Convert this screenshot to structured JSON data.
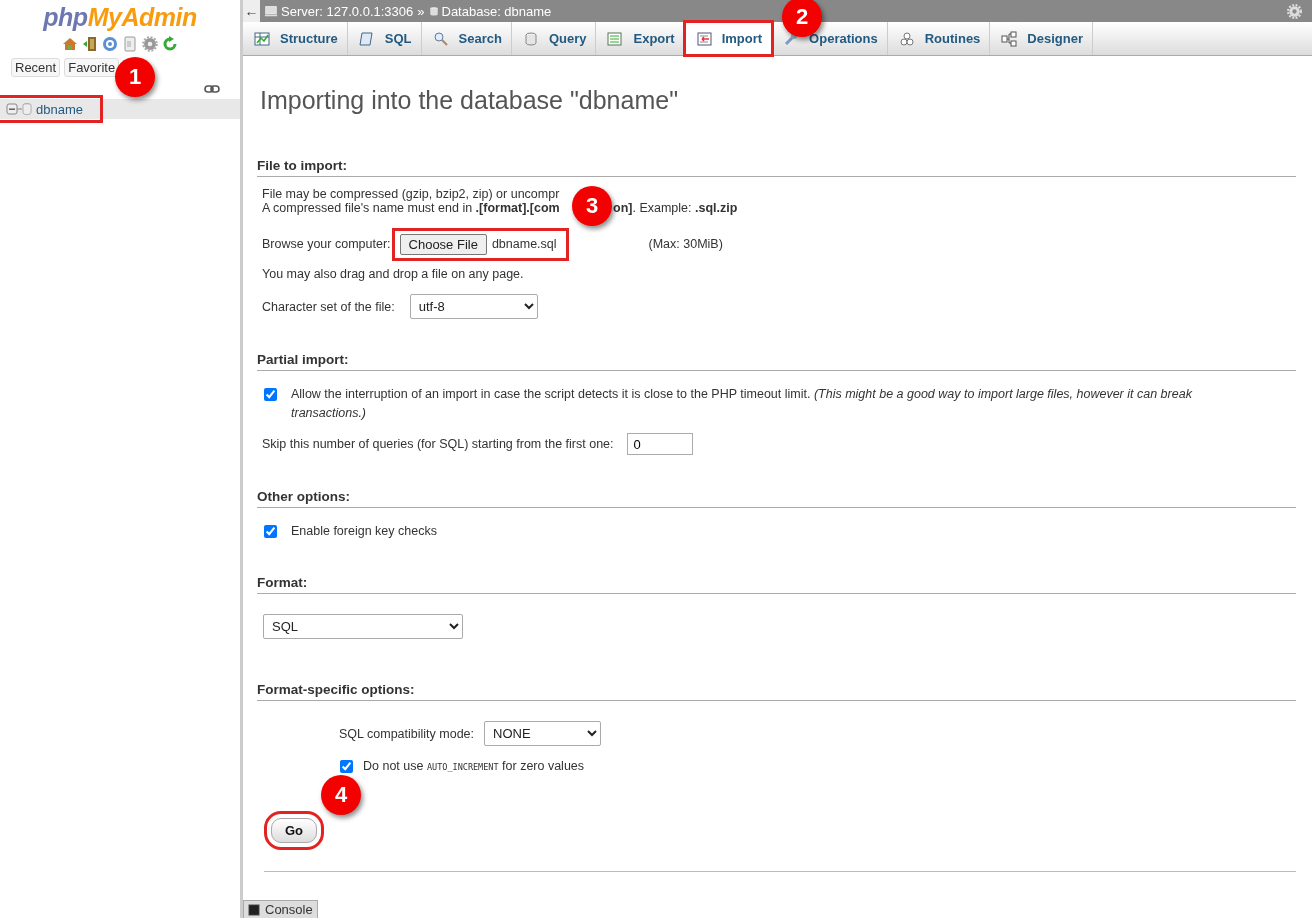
{
  "sidebar": {
    "logo": [
      "php",
      "MyAdmin"
    ],
    "buttons": [
      "Recent",
      "Favorite"
    ],
    "tree": [
      {
        "label": "dbname",
        "expanded": true,
        "highlighted": true
      }
    ]
  },
  "breadcrumb": {
    "back": "←",
    "items": [
      "Server: 127.0.0.1:3306",
      "Database: dbname"
    ],
    "separator": "»"
  },
  "tabs": [
    {
      "label": "Structure",
      "selected": false,
      "highlighted": false
    },
    {
      "label": "SQL",
      "selected": false,
      "highlighted": false
    },
    {
      "label": "Search",
      "selected": false,
      "highlighted": false
    },
    {
      "label": "Query",
      "selected": false,
      "highlighted": false
    },
    {
      "label": "Export",
      "selected": false,
      "highlighted": false
    },
    {
      "label": "Import",
      "selected": true,
      "highlighted": true
    },
    {
      "label": "Operations",
      "selected": false,
      "highlighted": false
    },
    {
      "label": "Routines",
      "selected": false,
      "highlighted": false
    },
    {
      "label": "Designer",
      "selected": false,
      "highlighted": false
    }
  ],
  "title": "Importing into the database \"dbname\"",
  "file_to_import": {
    "heading": "File to import:",
    "note_line1": "File may be compressed (gzip, bzip2, zip) or uncompr",
    "note_line2": [
      "A compressed file's name must end in **.[format].[com**",
      "**on]**. Example: **.sql.zip**"
    ],
    "browse_label": "Browse your computer:",
    "choose_button": "Choose File",
    "file_name": "dbname.sql",
    "highlighted": true,
    "max": "(Max: 30MiB)",
    "drag_note": "You may also drag and drop a file on any page.",
    "charset_label": "Character set of the file:",
    "charset": "utf-8"
  },
  "partial_import": {
    "heading": "Partial import:",
    "allow_interrupt": {
      "checked": true,
      "text": "Allow the interruption of an import in case the script detects it is close to the PHP timeout limit. *(This might be a good way to import large files, however it can break transactions.)*"
    },
    "skip_label": "Skip this number of queries (for SQL) starting from the first one:",
    "skip_value": "0"
  },
  "other_options": {
    "heading": "Other options:",
    "foreign_keys": {
      "checked": true,
      "text": "Enable foreign key checks"
    }
  },
  "format": {
    "heading": "Format:",
    "value": "SQL"
  },
  "format_specific": {
    "heading": "Format-specific options:",
    "compat_label": "SQL compatibility mode:",
    "compat_value": "NONE",
    "auto_increment": {
      "checked": true,
      "parts": [
        "Do not use",
        "AUTO_INCREMENT",
        "for zero values"
      ]
    }
  },
  "go_button": {
    "label": "Go",
    "highlighted": true
  },
  "console": {
    "label": "Console"
  },
  "callouts": [
    "1",
    "2",
    "3",
    "4"
  ]
}
